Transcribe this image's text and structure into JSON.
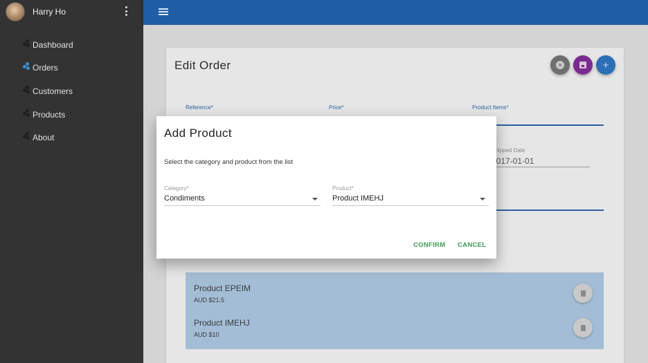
{
  "sidebar": {
    "user_name": "Harry Ho",
    "items": [
      {
        "label": "Dashboard"
      },
      {
        "label": "Orders"
      },
      {
        "label": "Customers"
      },
      {
        "label": "Products"
      },
      {
        "label": "About"
      }
    ],
    "active_item": "Orders"
  },
  "colors": {
    "appbar": "#1f5ea5",
    "sidebar": "#333333",
    "accent_green": "#3d9a55",
    "save_fab": "#7b2b8f",
    "add_fab": "#2c6fb5"
  },
  "page": {
    "title": "Edit Order",
    "fields": {
      "reference_label": "Reference*",
      "price_label": "Price*",
      "product_items_label": "Product Items*",
      "shipped_date_label": "Shipped Date",
      "shipped_date_value": "2017-01-01"
    },
    "product_items": [
      {
        "name": "Product EPEIM",
        "price": "AUD $21.5"
      },
      {
        "name": "Product IMEHJ",
        "price": "AUD $10"
      }
    ]
  },
  "dialog": {
    "title": "Add Product",
    "description": "Select the category and product from the list",
    "category_label": "Category*",
    "category_value": "Condiments",
    "product_label": "Product*",
    "product_value": "Product IMEHJ",
    "confirm_label": "CONFIRM",
    "cancel_label": "CANCEL"
  }
}
